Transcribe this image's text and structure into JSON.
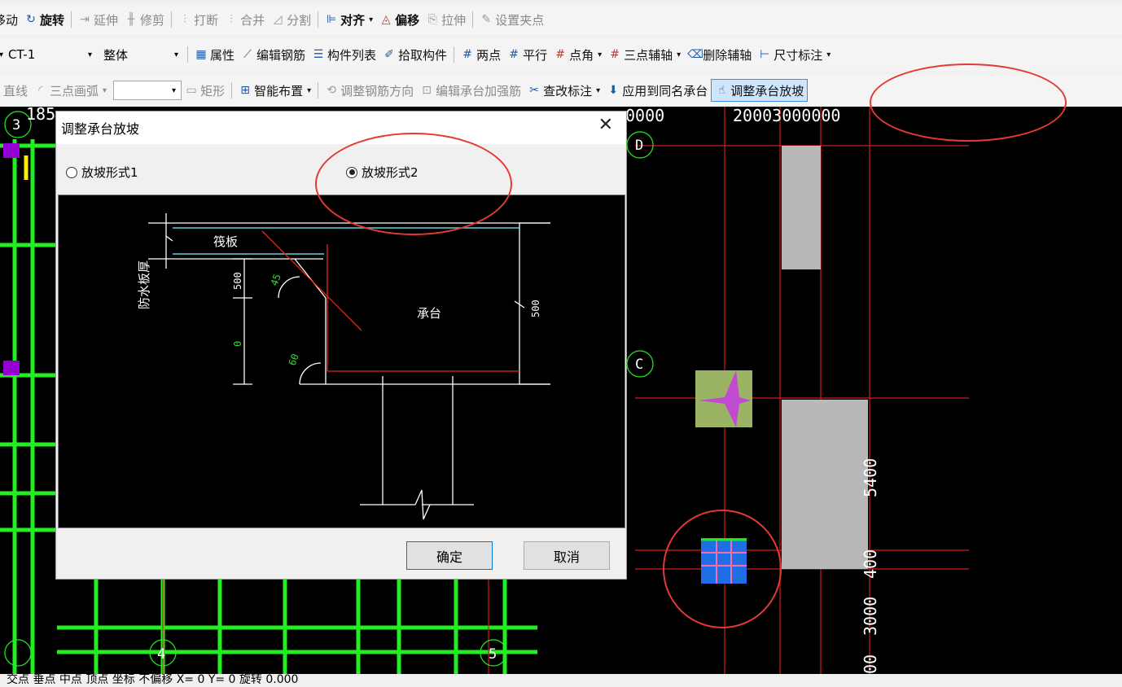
{
  "toolbar1": {
    "move": "移动",
    "rotate": "旋转",
    "extend": "延伸",
    "trim": "修剪",
    "break": "打断",
    "merge": "合并",
    "split": "分割",
    "align": "对齐",
    "offset": "偏移",
    "stretch": "拉伸",
    "grip": "设置夹点"
  },
  "toolbar2": {
    "component": "CT-1",
    "scope": "整体",
    "properties": "属性",
    "edit_rebar": "编辑钢筋",
    "component_list": "构件列表",
    "pick_component": "拾取构件",
    "two_point": "两点",
    "parallel": "平行",
    "point_angle": "点角",
    "three_point_axis": "三点辅轴",
    "delete_axis": "删除辅轴",
    "dimension": "尺寸标注"
  },
  "toolbar3": {
    "line": "直线",
    "arc": "三点画弧",
    "rect": "矩形",
    "smart_place": "智能布置",
    "adjust_rebar_dir": "调整钢筋方向",
    "edit_reinforce": "编辑承台加强筋",
    "edit_label": "查改标注",
    "apply_same": "应用到同名承台",
    "adjust_slope": "调整承台放坡"
  },
  "canvas": {
    "axis_labels": [
      "3",
      "D",
      "C",
      "4",
      "5"
    ],
    "dims": {
      "top_left": "185",
      "top_mid": "0000",
      "top_right": "20003000000",
      "right_1": "5400",
      "right_2": "400",
      "right_3": "3000",
      "right_4": "00"
    }
  },
  "dialog": {
    "title": "调整承台放坡",
    "option1": "放坡形式1",
    "option2": "放坡形式2",
    "selected": "option2",
    "ok": "确定",
    "cancel": "取消",
    "diagram": {
      "raft": "筏板",
      "waterproof": "防水板厚",
      "cap": "承台",
      "dim_500_left": "500",
      "dim_0": "0",
      "dim_500_right": "500",
      "angle_45": "45",
      "angle_60": "60"
    }
  },
  "statusbar": {
    "text": "交点  垂点  中点  顶点  坐标  不偏移  X=  0  Y=  0  旋转  0.000"
  }
}
